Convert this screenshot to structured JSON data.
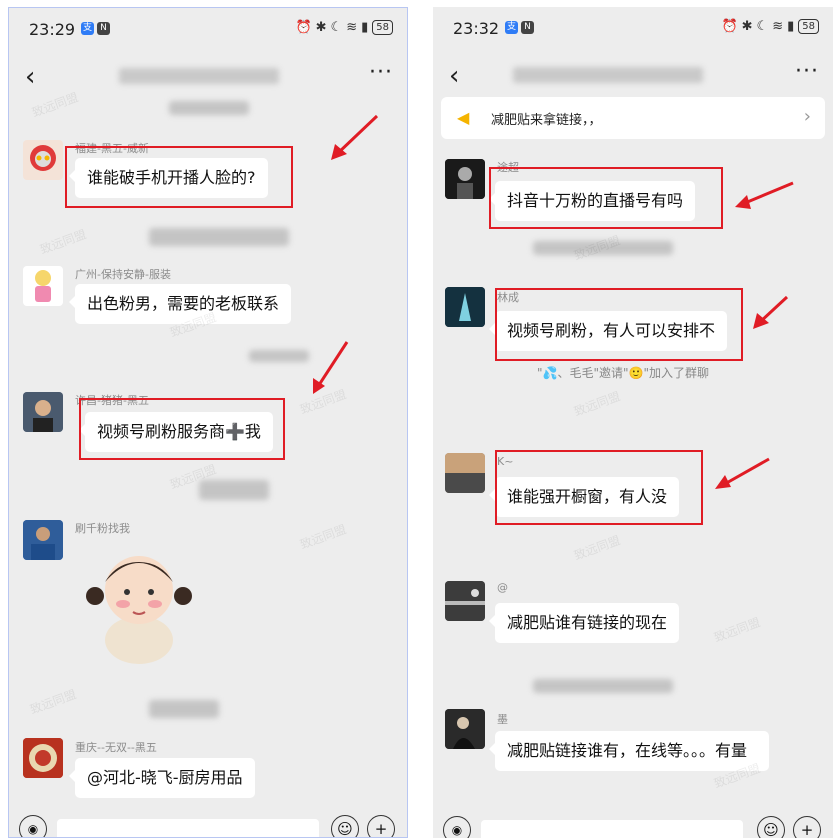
{
  "left": {
    "status": {
      "time": "23:29",
      "battery": "58"
    },
    "messages": [
      {
        "sender": "福建-黑五-威新",
        "text": "谁能破手机开播人脸的?"
      },
      {
        "sender": "广州-保持安静-服装",
        "text": "出色粉男，需要的老板联系"
      },
      {
        "sender": "许昌-猪猪-黑五",
        "text": "视频号刷粉服务商➕我"
      },
      {
        "sender": "刷千粉找我",
        "text": ""
      },
      {
        "sender": "重庆--无双--黑五",
        "text": "@河北-晓飞-厨房用品"
      }
    ],
    "watermark": "致远同盟"
  },
  "right": {
    "status": {
      "time": "23:32",
      "battery": "58"
    },
    "notice": "减肥贴来拿链接，，",
    "messages": [
      {
        "sender": "途超",
        "text": "抖音十万粉的直播号有吗"
      },
      {
        "sender": "林成",
        "text": "视频号刷粉，有人可以安排不"
      },
      {
        "sender": "K~",
        "text": "谁能强开橱窗，有人没"
      },
      {
        "sender": "@",
        "text": "减肥贴谁有链接的现在"
      },
      {
        "sender": "墨",
        "text": "减肥贴链接谁有，在线等。。。有量"
      }
    ],
    "system": "\"💦、毛毛\"邀请\"🙂\"加入了群聊",
    "watermark": "致远同盟"
  },
  "icons": {
    "back": "back-chevron-icon",
    "more": "more-dots-icon",
    "speaker": "speaker-icon",
    "voice": "voice-icon",
    "emoji": "emoji-icon",
    "plus": "plus-icon"
  },
  "colors": {
    "highlight": "#e01c25",
    "chat_bg": "#ededed",
    "bubble": "#ffffff"
  }
}
